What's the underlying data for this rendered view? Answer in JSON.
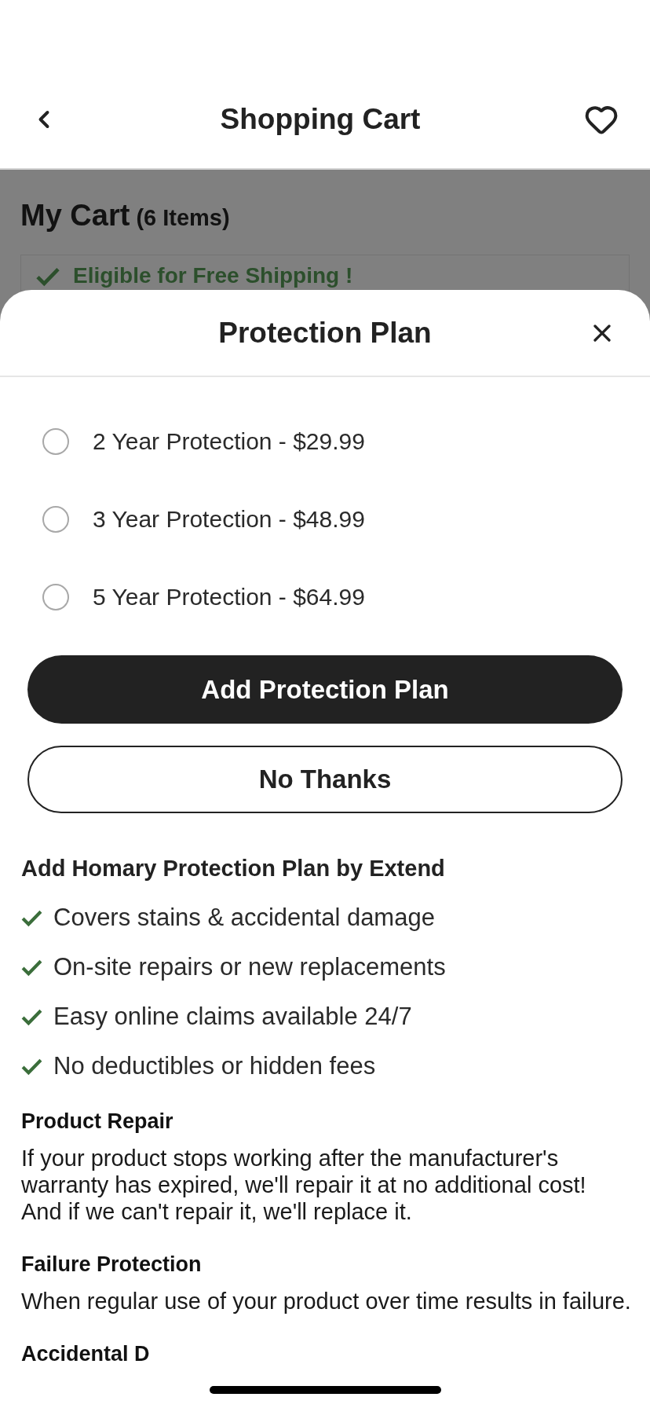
{
  "header": {
    "title": "Shopping Cart"
  },
  "cart": {
    "title": "My Cart",
    "count": "(6 Items)",
    "shipping_notice": "Eligible for Free Shipping !"
  },
  "sheet": {
    "title": "Protection Plan",
    "options": [
      {
        "label": "2 Year Protection - $29.99",
        "selected": false
      },
      {
        "label": "3 Year Protection - $48.99",
        "selected": false
      },
      {
        "label": "5 Year Protection - $64.99",
        "selected": false
      }
    ],
    "buttons": [
      {
        "kind": "primary",
        "label": "Add Protection Plan"
      },
      {
        "kind": "outline",
        "label": "No Thanks"
      }
    ],
    "benefits_title": "Add Homary Protection Plan by Extend",
    "benefits": [
      "Covers stains & accidental damage",
      "On-site repairs or new replacements",
      "Easy online claims available 24/7",
      "No deductibles or hidden fees"
    ],
    "sections": [
      {
        "title": "Product Repair",
        "text": "If your product stops working after the manufacturer's warranty has expired, we'll repair it at no additional cost!\nAnd if we can't repair it, we'll replace it."
      },
      {
        "title": "Failure Protection",
        "text": "When regular use of your product over time results in failure."
      },
      {
        "title": "Accidental D"
      }
    ]
  }
}
